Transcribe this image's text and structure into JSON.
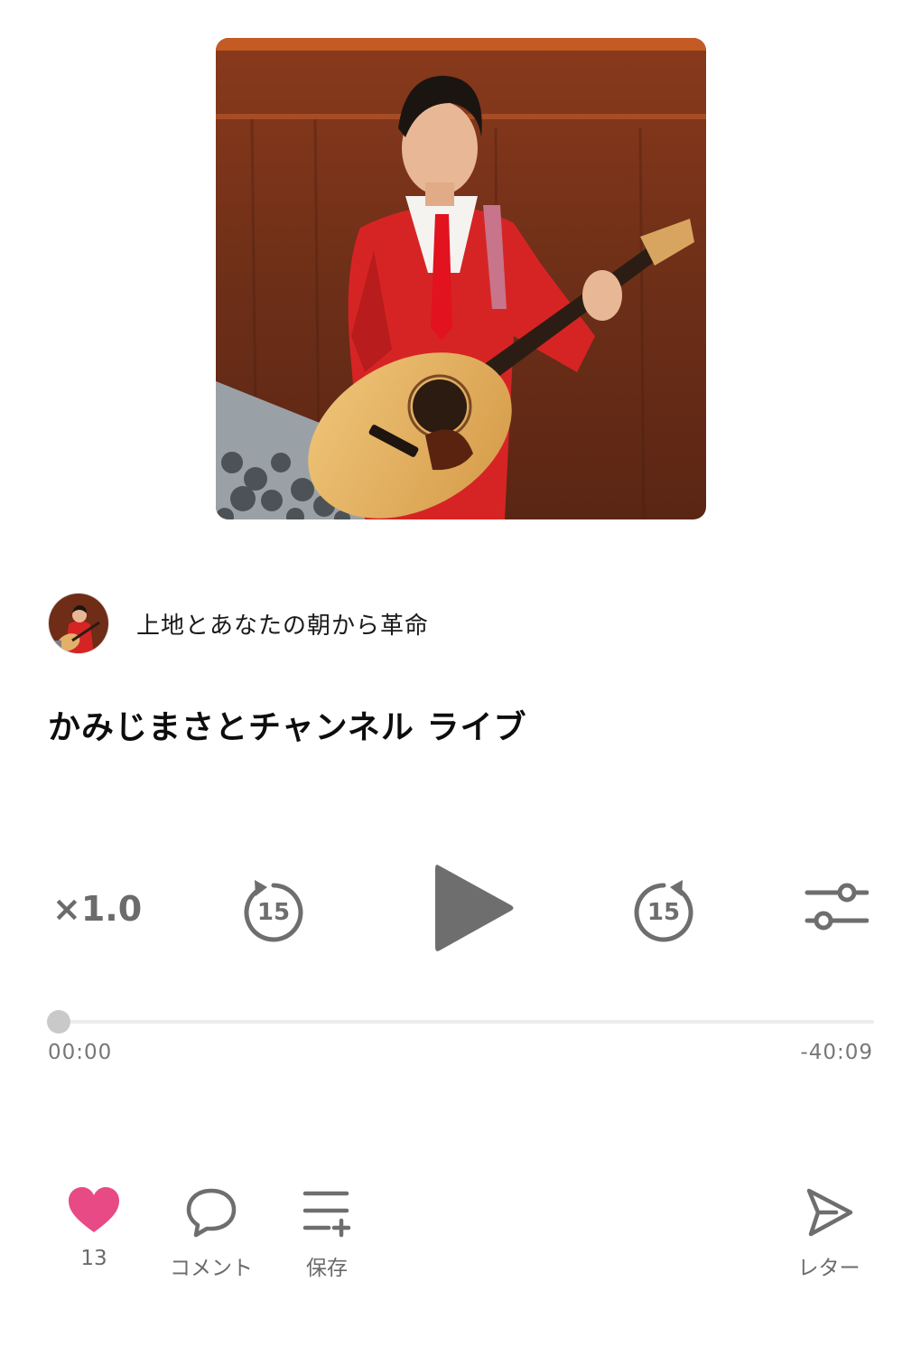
{
  "channel": {
    "name": "上地とあなたの朝から革命"
  },
  "episode": {
    "title": "かみじまさとチャンネル ライブ"
  },
  "player": {
    "speed_label": "×1.0",
    "skip_back_seconds": "15",
    "skip_forward_seconds": "15",
    "state": "paused",
    "progress_fraction": 0.0,
    "elapsed": "00:00",
    "remaining": "-40:09"
  },
  "actions": {
    "like_count": "13",
    "comment_label": "コメント",
    "save_label": "保存",
    "letter_label": "レター"
  },
  "colors": {
    "like_accent": "#e84a86",
    "control_gray": "#6e6e6e"
  },
  "icons": {
    "play": "play-icon",
    "skip_back": "rewind-15-icon",
    "skip_forward": "forward-15-icon",
    "settings": "sliders-icon",
    "like": "heart-icon",
    "comment": "speech-bubble-icon",
    "save": "playlist-add-icon",
    "letter": "send-icon"
  }
}
